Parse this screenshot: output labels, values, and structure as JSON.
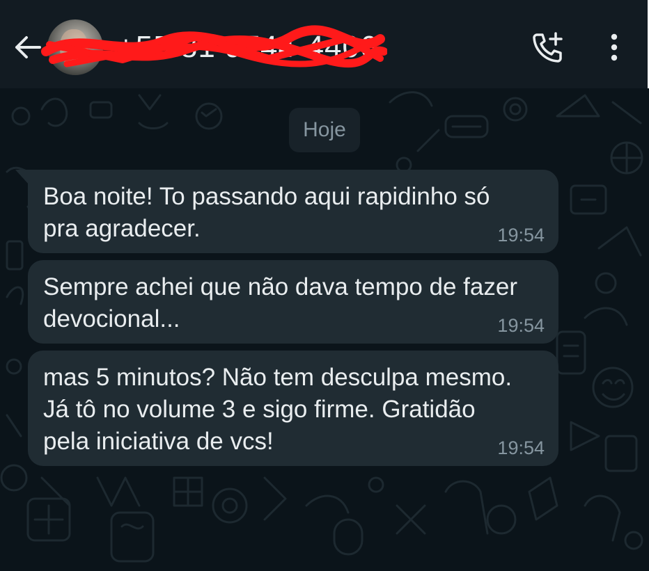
{
  "header": {
    "contact_name": "+55 81 9744-4406",
    "back_icon": "arrow-left-icon",
    "add_call_icon": "add-call-icon",
    "menu_icon": "vertical-dots-icon",
    "background": "#121b22"
  },
  "chat": {
    "background": "#0b141a",
    "bubble_color": "#202c33",
    "date_label": "Hoje",
    "messages": [
      {
        "text": "Boa noite! To passando aqui rapidinho só pra agradecer.",
        "time": "19:54"
      },
      {
        "text": "Sempre achei que não dava tempo de fazer devocional...",
        "time": "19:54"
      },
      {
        "text": "mas 5 minutos? Não tem desculpa mesmo. Já tô no volume 3 e sigo firme. Gratidão pela iniciativa de vcs!",
        "time": "19:54"
      }
    ]
  }
}
